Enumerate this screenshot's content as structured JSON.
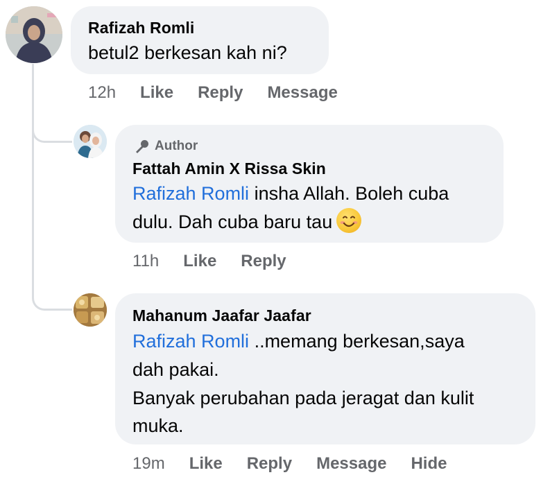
{
  "comments": [
    {
      "author": "Rafizah Romli",
      "text": "betul2 berkesan kah ni?",
      "time": "12h",
      "actions": [
        "Like",
        "Reply",
        "Message"
      ]
    }
  ],
  "replies": [
    {
      "badge": "Author",
      "author": "Fattah Amin X Rissa Skin",
      "mention": "Rafizah Romli",
      "line1": " insha Allah. Boleh cuba",
      "line2": "dulu. Dah cuba baru tau",
      "emoji": "smiling-face",
      "time": "11h",
      "actions": [
        "Like",
        "Reply"
      ]
    },
    {
      "author": "Mahanum Jaafar Jaafar",
      "mention": "Rafizah Romli",
      "line1": " ..memang berkesan,saya",
      "line2": "dah pakai.",
      "line3": "Banyak perubahan pada jeragat dan kulit",
      "line4": "muka.",
      "time": "19m",
      "actions": [
        "Like",
        "Reply",
        "Message",
        "Hide"
      ]
    }
  ],
  "colors": {
    "bubble": "#f0f2f5",
    "mention": "#216fdb",
    "secondary_text": "#65676b",
    "thread_line": "#dadde1"
  }
}
